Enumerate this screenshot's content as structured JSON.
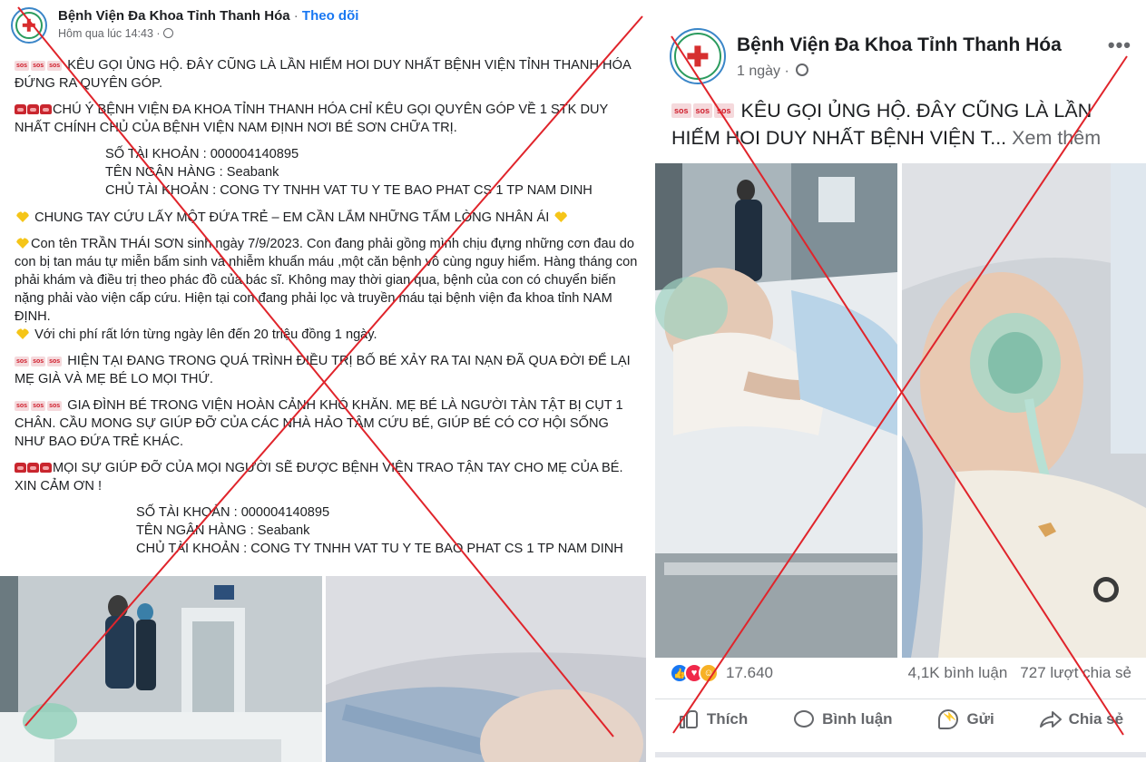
{
  "left_post": {
    "page_name": "Bệnh Viện Đa Khoa Tỉnh Thanh Hóa",
    "separator": "·",
    "follow_label": "Theo dõi",
    "timestamp": "Hôm qua lúc 14:43 ·",
    "paragraphs": {
      "p1": "KÊU GỌI ỦNG HỘ. ĐÂY CŨNG LÀ LẦN HIẾM HOI DUY NHẤT BỆNH VIỆN TỈNH THANH HÓA ĐỨNG RA QUYÊN GÓP.",
      "p2": "CHÚ Ý BỆNH VIỆN ĐA KHOA TỈNH THANH HÓA CHỈ KÊU GỌI QUYÊN GÓP VỀ 1 STK DUY NHẤT CHÍNH CHỦ CỦA BỆNH VIỆN NAM ĐỊNH NƠI BÉ SƠN CHỮA TRỊ.",
      "account_number_1": "SỐ TÀI KHOẢN : 000004140895",
      "bank_name_1": "TÊN NGÂN HÀNG : Seabank",
      "account_holder_1": "CHỦ TÀI KHOẢN : CONG TY TNHH VAT TU Y TE BAO PHAT CS 1 TP NAM DINH",
      "p3": "CHUNG TAY CỨU LẤY MỘT ĐỨA TRẺ – EM CẦN LẮM NHỮNG TẤM LÒNG NHÂN ÁI",
      "p4": "Con tên TRẦN THÁI SƠN sinh ngày 7/9/2023. Con đang phải gồng mình chịu đựng những cơn đau do con bị tan máu tự miễn bẩm sinh và nhiễm khuẩn máu ,một căn bệnh vô cùng nguy hiểm. Hàng tháng con phải khám và điều trị theo phác đồ của bác sĩ. Không may thời gian qua, bệnh của con có chuyển biến nặng phải vào viện cấp cứu. Hiện tại con đang phải lọc và truyền máu tại bệnh viện đa khoa tỉnh NAM ĐỊNH.",
      "p5": "Với chi phí rất lớn từng ngày lên đến 20 triệu đồng 1 ngày.",
      "p6": "HIỆN TẠI ĐANG TRONG QUÁ TRÌNH ĐIỀU TRỊ BỐ BÉ XẢY RA TAI NẠN ĐÃ QUA ĐỜI ĐỂ LẠI MẸ GIÀ VÀ MẸ BÉ LO MỌI THỨ.",
      "p7": "GIA ĐÌNH BÉ TRONG VIỆN HOÀN CẢNH KHÓ KHĂN. MẸ BÉ LÀ NGƯỜI TÀN TẬT BỊ CỤT 1 CHÂN. CẦU MONG SỰ GIÚP ĐỠ CỦA CÁC NHÀ HẢO TÂM CỨU BÉ, GIÚP BÉ CÓ CƠ HỘI SỐNG NHƯ BAO ĐỨA TRẺ KHÁC.",
      "p8": "MỌI SỰ GIÚP ĐỠ CỦA MỌI NGƯỜI SẼ ĐƯỢC BỆNH VIỆN TRAO TẬN TAY CHO MẸ CỦA BÉ. XIN CẢM ƠN !",
      "account_number_2": "SỐ TÀI KHOẢN : 000004140895",
      "bank_name_2": "TÊN NGÂN HÀNG : Seabank",
      "account_holder_2": "CHỦ TÀI KHOẢN : CONG TY TNHH VAT TU Y TE BAO PHAT CS 1 TP NAM DINH"
    },
    "emoji_labels": {
      "sos": "sos"
    }
  },
  "right_post": {
    "page_name": "Bệnh Viện Đa Khoa Tỉnh Thanh Hóa",
    "timestamp": "1 ngày ·",
    "more_label": "•••",
    "text": "KÊU GỌI ỦNG HỘ. ĐÂY CŨNG LÀ LẦN HIẾM HOI DUY NHẤT BỆNH VIỆN T...",
    "see_more": "Xem thêm",
    "reaction_count": "17.640",
    "comment_count": "4,1K bình luận",
    "share_count": "727 lượt chia sẻ",
    "actions": {
      "like": "Thích",
      "comment": "Bình luận",
      "send": "Gửi",
      "share": "Chia sẻ"
    }
  },
  "colors": {
    "facebook_blue": "#1877f2",
    "secondary_text": "#65676b",
    "cross_out_red": "#e0242b",
    "sos_red": "#d0202e"
  },
  "icons": [
    "globe-icon",
    "sos-icon",
    "phone-icon",
    "yellow-heart-icon",
    "more-options-icon",
    "like-reaction-icon",
    "love-reaction-icon",
    "care-reaction-icon",
    "like-icon",
    "comment-icon",
    "messenger-icon",
    "share-icon"
  ]
}
